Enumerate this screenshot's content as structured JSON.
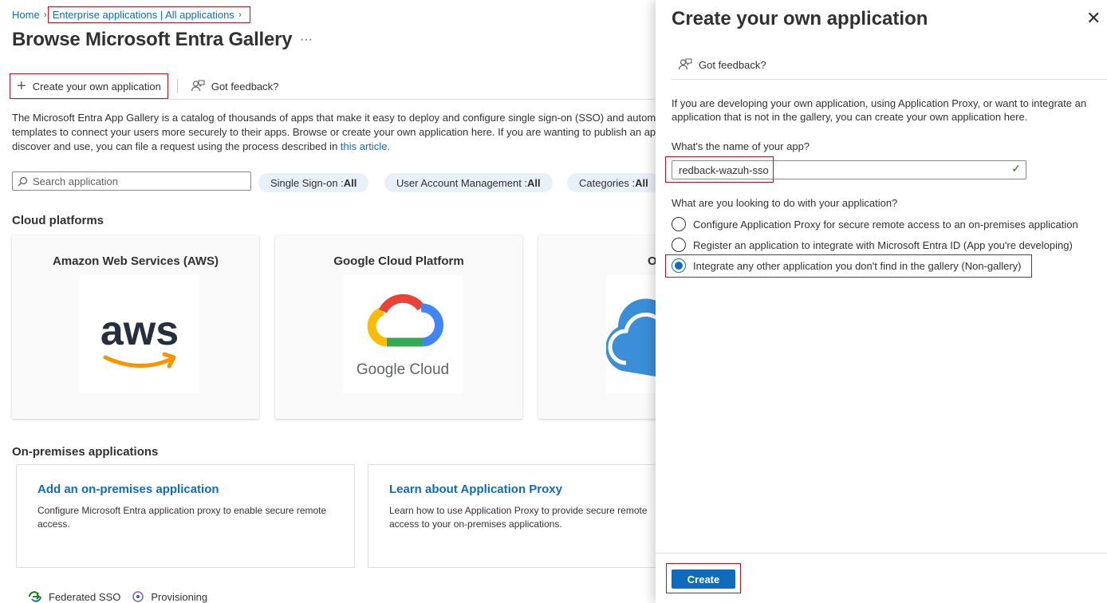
{
  "breadcrumb": {
    "home": "Home",
    "current": "Enterprise applications | All applications"
  },
  "page": {
    "title": "Browse Microsoft Entra Gallery",
    "more": "···",
    "description_part1": "The Microsoft Entra App Gallery is a catalog of thousands of apps that make it easy to deploy and configure single sign-on (SSO) and automa",
    "description_part2": "templates to connect your users more securely to their apps. Browse or create your own application here. If you are wanting to publish an app",
    "description_part3": "discover and use, you can file a request using the process described in ",
    "description_link": "this article."
  },
  "toolbar": {
    "create_label": "Create your own application",
    "feedback_label": "Got feedback?"
  },
  "search": {
    "placeholder": "Search application"
  },
  "filters": [
    {
      "label": "Single Sign-on : ",
      "value": "All"
    },
    {
      "label": "User Account Management : ",
      "value": "All"
    },
    {
      "label": "Categories : ",
      "value": "All"
    }
  ],
  "cloud": {
    "title": "Cloud platforms",
    "cards": [
      {
        "name": "Amazon Web Services (AWS)",
        "logo_text": "aws"
      },
      {
        "name": "Google Cloud Platform",
        "logo_text": "Google Cloud"
      },
      {
        "name": "O"
      }
    ]
  },
  "onprem": {
    "title": "On-premises applications",
    "cards": [
      {
        "title": "Add an on-premises application",
        "desc": "Configure Microsoft Entra application proxy to enable secure remote access."
      },
      {
        "title": "Learn about Application Proxy",
        "desc": "Learn how to use Application Proxy to provide secure remote access to your on-premises applications."
      }
    ]
  },
  "footer": {
    "federated": "Federated SSO",
    "provisioning": "Provisioning"
  },
  "panel": {
    "title": "Create your own application",
    "feedback": "Got feedback?",
    "desc": "If you are developing your own application, using Application Proxy, or want to integrate an application that is not in the gallery, you can create your own application here.",
    "name_label": "What's the name of your app?",
    "name_value": "redback-wazuh-sso",
    "purpose_label": "What are you looking to do with your application?",
    "options": [
      "Configure Application Proxy for secure remote access to an on-premises application",
      "Register an application to integrate with Microsoft Entra ID (App you're developing)",
      "Integrate any other application you don't find in the gallery (Non-gallery)"
    ],
    "selected_option": 2,
    "create_label": "Create"
  },
  "colors": {
    "accent": "#0f6cbd",
    "highlight": "#c50f1f",
    "pill": "#e8f0f9"
  }
}
